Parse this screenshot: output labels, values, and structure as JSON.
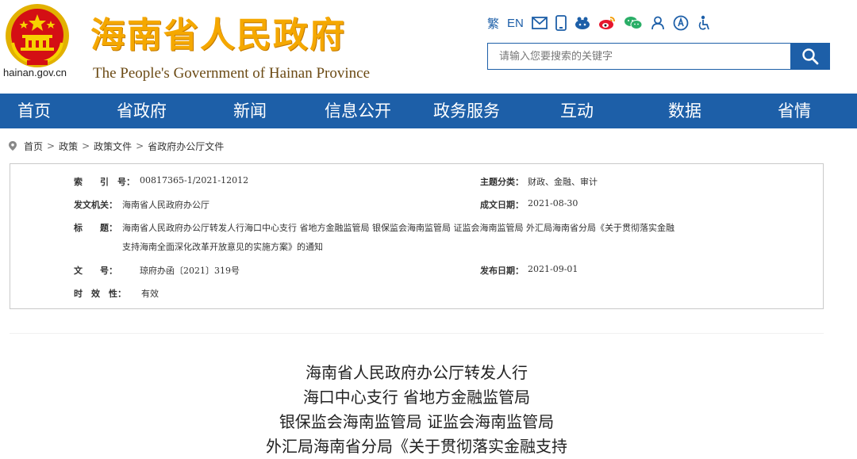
{
  "header": {
    "domain": "hainan.gov.cn",
    "title_cn": "海南省人民政府",
    "title_en": "The People's Government  of Hainan Province"
  },
  "tools": {
    "traditional": "繁",
    "english": "EN",
    "icons": [
      "mail-icon",
      "mobile-icon",
      "app-icon",
      "weibo-icon",
      "wechat-icon",
      "user-icon",
      "accessibility-icon",
      "elder-mode-icon"
    ]
  },
  "search": {
    "placeholder": "请输入您要搜索的关键字"
  },
  "nav": {
    "items": [
      "首页",
      "省政府",
      "新闻",
      "信息公开",
      "政务服务",
      "互动",
      "数据",
      "省情"
    ]
  },
  "breadcrumb": {
    "items": [
      "首页",
      "政策",
      "政策文件",
      "省政府办公厅文件"
    ],
    "separator": ">"
  },
  "meta": {
    "index_label": "索　　引　号：",
    "index_value": "00817365-1/2021-12012",
    "topic_label": "主题分类：",
    "topic_value": "财政、金融、审计",
    "issuer_label": "发文机关：",
    "issuer_value": "海南省人民政府办公厅",
    "date_label": "成文日期：",
    "date_value": "2021-08-30",
    "title_label": "标　　题：",
    "title_line1": "海南省人民政府办公厅转发人行海口中心支行 省地方金融监管局 银保监会海南监管局 证监会海南监管局 外汇局海南省分局《关于贯彻落实金融",
    "title_line2": "支持海南全面深化改革开放意见的实施方案》的通知",
    "doc_no_label": "文　　号：",
    "doc_no_value": "琼府办函〔2021〕319号",
    "publish_label": "发布日期：",
    "publish_value": "2021-09-01",
    "validity_label": "时　效　性：",
    "validity_value": "有效"
  },
  "document": {
    "title_lines": [
      "海南省人民政府办公厅转发人行",
      "海口中心支行 省地方金融监管局",
      "银保监会海南监管局 证监会海南监管局",
      "外汇局海南省分局《关于贯彻落实金融支持"
    ]
  },
  "colors": {
    "brand_blue": "#1d5fa8",
    "title_gold": "#f5a800",
    "emblem_red": "#d40f14"
  }
}
